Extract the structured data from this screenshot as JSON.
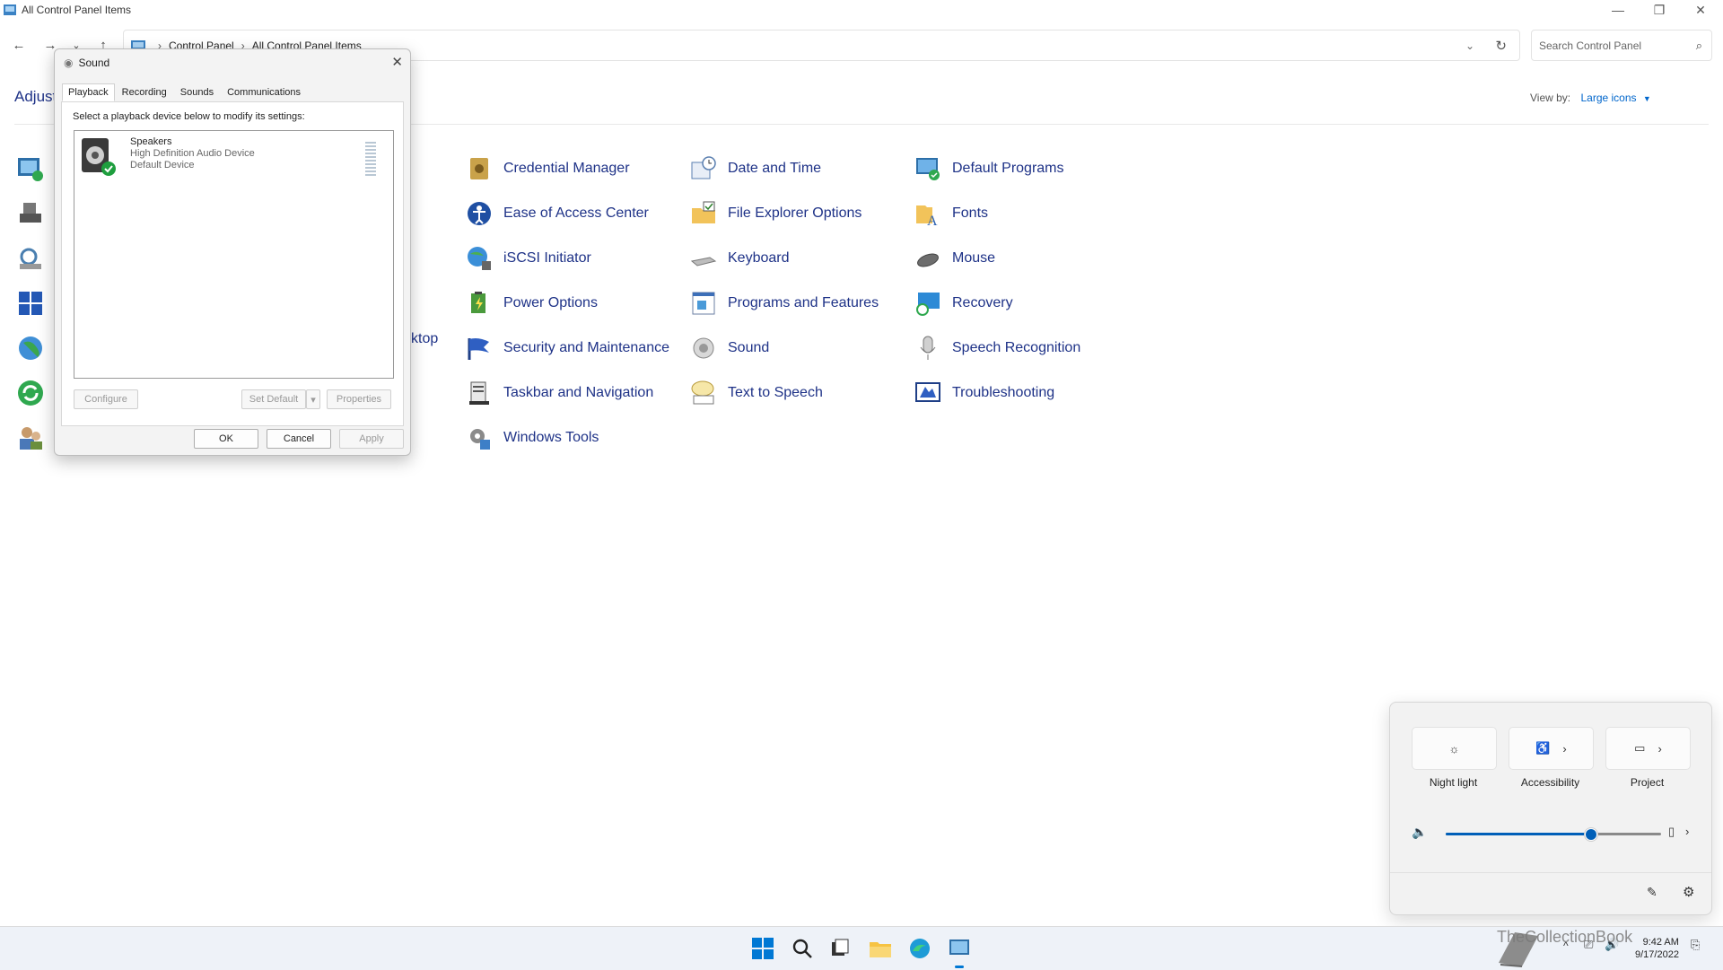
{
  "window": {
    "title": "All Control Panel Items",
    "controls": {
      "minimize": "—",
      "restore": "❐",
      "close": "✕"
    }
  },
  "address": {
    "crumbs": [
      "Control Panel",
      "All Control Panel Items"
    ],
    "search_placeholder": "Search Control Panel"
  },
  "header": {
    "title": "Adjust",
    "view_by_label": "View by:",
    "view_by_value": "Large icons"
  },
  "items": {
    "col1": [
      "Credential Manager",
      "Ease of Access Center",
      "iSCSI Initiator",
      "Power Options",
      "Security and Maintenance",
      "Taskbar and Navigation",
      "Windows Tools"
    ],
    "col2": [
      "Date and Time",
      "File Explorer Options",
      "Keyboard",
      "Programs and Features",
      "Sound",
      "Text to Speech"
    ],
    "col3": [
      "Default Programs",
      "Fonts",
      "Mouse",
      "Recovery",
      "Speech Recognition",
      "Troubleshooting"
    ],
    "partial_text": "ktop"
  },
  "sound_dialog": {
    "title": "Sound",
    "tabs": [
      "Playback",
      "Recording",
      "Sounds",
      "Communications"
    ],
    "instruction": "Select a playback device below to modify its settings:",
    "device": {
      "name": "Speakers",
      "driver": "High Definition Audio Device",
      "status": "Default Device"
    },
    "buttons": {
      "configure": "Configure",
      "set_default": "Set Default",
      "properties": "Properties",
      "ok": "OK",
      "cancel": "Cancel",
      "apply": "Apply"
    }
  },
  "quick_settings": {
    "tiles": [
      "Night light",
      "Accessibility",
      "Project"
    ],
    "volume_percent": 67
  },
  "taskbar": {
    "time": "9:42 AM",
    "date": "9/17/2022",
    "watermark": "TheCollectionBook"
  },
  "colors": {
    "link": "#1e3287",
    "accent": "#005fb8",
    "taskbar_bg": "#eef2f8"
  }
}
